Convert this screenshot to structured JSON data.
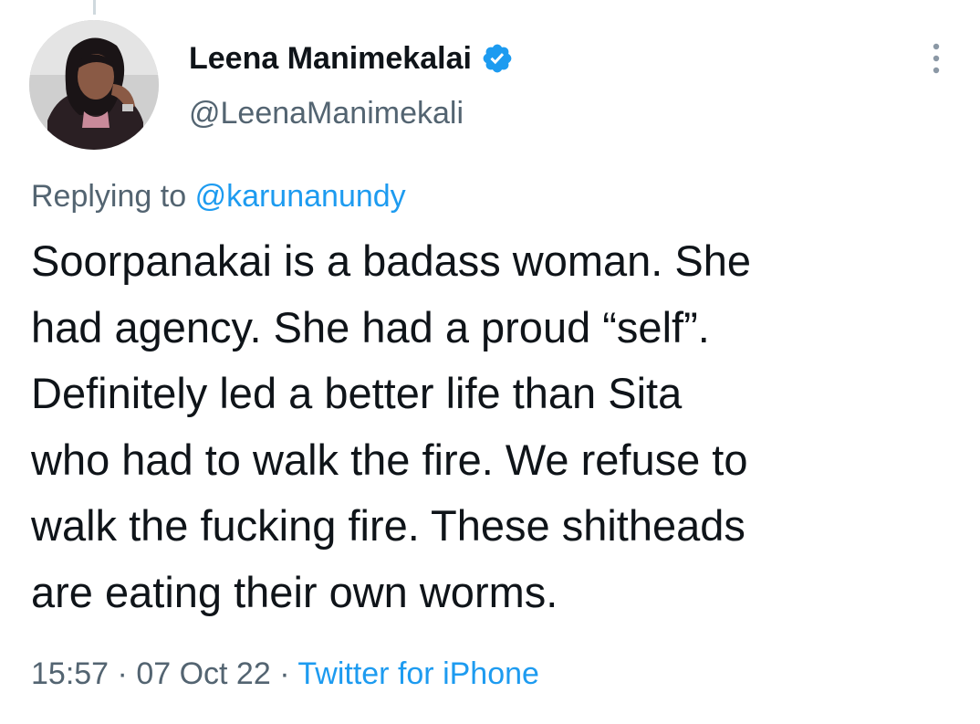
{
  "author": {
    "display_name": "Leena Manimekalai",
    "handle": "@LeenaManimekali",
    "verified": true,
    "verified_icon": "verified-badge-icon",
    "avatar": "profile-photo-avatar"
  },
  "menu": {
    "icon": "more-options-icon"
  },
  "reply": {
    "prefix": "Replying to",
    "mention": "@karunanundy"
  },
  "tweet": {
    "lines": [
      "Soorpanakai is a badass woman. She",
      "had agency. She had a proud “self”.",
      "Definitely led a better life than Sita",
      "who had to walk the fire. We refuse to",
      "walk the fucking fire. These shitheads",
      "are eating their own worms."
    ]
  },
  "meta": {
    "time": "15:57",
    "separator": "·",
    "date": "07 Oct 22",
    "source": "Twitter for iPhone"
  },
  "colors": {
    "text": "#0f1419",
    "secondary": "#536471",
    "accent": "#1d9bf0"
  }
}
